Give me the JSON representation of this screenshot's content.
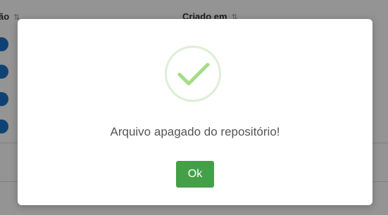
{
  "background": {
    "table_headers": [
      "ão",
      "Criado em"
    ],
    "sort_icon": "sort-icon"
  },
  "modal": {
    "icon": "checkmark-icon",
    "message": "Arquivo apagado do repositório!",
    "ok_label": "Ok",
    "ok_color": "#44a047",
    "icon_color": "#a5dc86"
  }
}
